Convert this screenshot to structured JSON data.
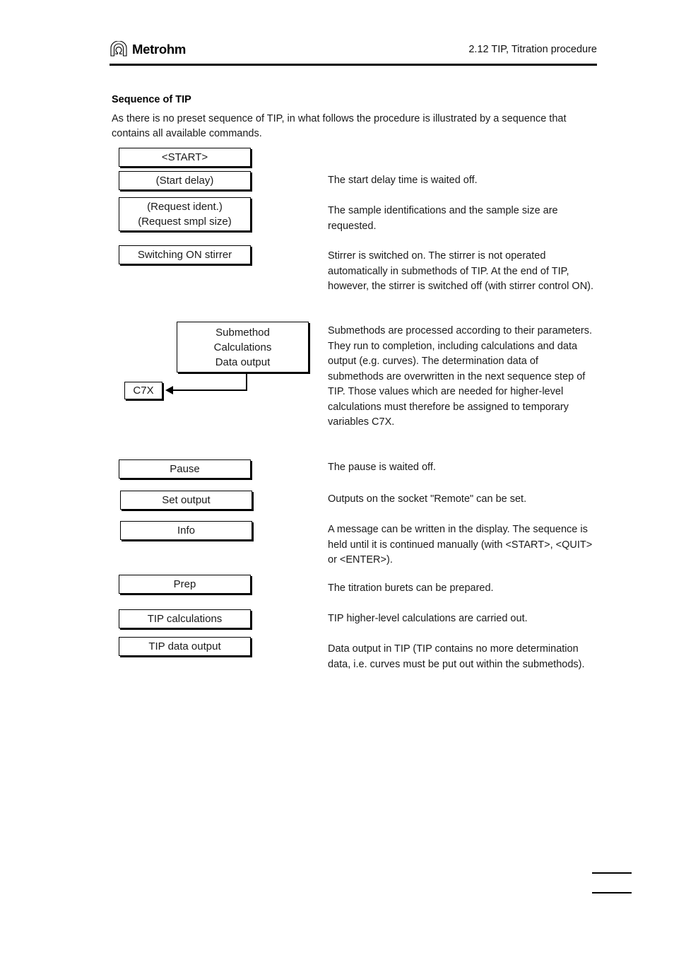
{
  "header": {
    "brand": "Metrohm",
    "logo_icon": "metrohm-omega-arch-logo",
    "title": "2.12 TIP, Titration procedure"
  },
  "content": {
    "section_title": "Sequence of TIP",
    "intro": "As there is no preset sequence of TIP, in what follows the procedure is illustrated by a sequence that contains all available commands."
  },
  "flowchart": {
    "nodes": [
      {
        "id": "start",
        "lines": [
          "<START>"
        ]
      },
      {
        "id": "start-delay",
        "lines": [
          "(Start delay)"
        ]
      },
      {
        "id": "request",
        "lines": [
          "(Request ident.)",
          "(Request smpl size)"
        ]
      },
      {
        "id": "switching-on-stirrer",
        "lines": [
          "Switching ON stirrer"
        ]
      },
      {
        "id": "submethod",
        "lines": [
          "Submethod",
          "Calculations",
          "Data output"
        ]
      },
      {
        "id": "c7x",
        "lines": [
          "C7X"
        ]
      },
      {
        "id": "pause",
        "lines": [
          "Pause"
        ]
      },
      {
        "id": "set-output",
        "lines": [
          "Set output"
        ]
      },
      {
        "id": "info",
        "lines": [
          "Info"
        ]
      },
      {
        "id": "prep",
        "lines": [
          "Prep"
        ]
      },
      {
        "id": "tip-calculations",
        "lines": [
          "TIP calculations"
        ]
      },
      {
        "id": "tip-data-output",
        "lines": [
          "TIP data output"
        ]
      }
    ]
  },
  "notes": [
    {
      "id": "note-start-delay",
      "text": "The start delay time is waited off."
    },
    {
      "id": "note-request",
      "text": "The sample identifications and the sample size are requested."
    },
    {
      "id": "note-stirrer",
      "text": "Stirrer is switched on. The stirrer is not operated automatically in submethods of TIP. At the end of TIP, however, the stirrer is switched off (with stirrer control ON)."
    },
    {
      "id": "note-submethod",
      "text": "Submethods are processed according to their parameters. They run to completion, including calculations and data output (e.g. curves). The determination data of submethods are overwritten in the next sequence step of TIP. Those values which are needed for higher-level calculations must therefore be assigned to temporary variables C7X."
    },
    {
      "id": "note-pause",
      "text": "The pause is waited off."
    },
    {
      "id": "note-set-output",
      "text": "Outputs on the socket \"Remote\" can be set."
    },
    {
      "id": "note-info",
      "text": "A message can be written in the display. The sequence is held until it is continued manually (with <START>, <QUIT> or <ENTER>)."
    },
    {
      "id": "note-prep",
      "text": "The titration burets can be prepared."
    },
    {
      "id": "note-tip-calculations",
      "text": "TIP higher-level calculations are carried out."
    },
    {
      "id": "note-tip-data-output",
      "text": "Data output in TIP (TIP contains no more determination data, i.e. curves must be put out within the submethods)."
    }
  ]
}
